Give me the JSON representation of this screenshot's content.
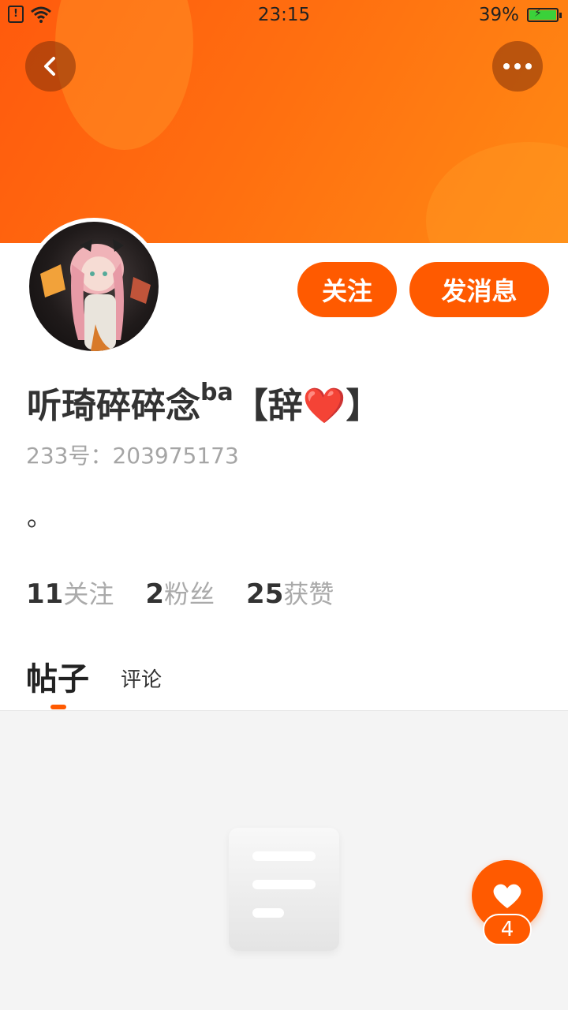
{
  "status_bar": {
    "time": "23:15",
    "battery_percent": "39%",
    "battery_level": 0.39
  },
  "header": {
    "back_icon": "chevron-left-icon",
    "more_icon": "more-dots-icon"
  },
  "profile": {
    "avatar": "anime-girl-avatar",
    "follow_label": "关注",
    "message_label": "发消息",
    "name_main": "听琦碎碎念",
    "name_sup": "ba",
    "name_bracket_open": "【辞",
    "name_heart": "❤️",
    "name_bracket_close": "】",
    "uid": "233号：203975173",
    "bio": "。"
  },
  "stats": {
    "following_count": "11",
    "following_label": "关注",
    "fans_count": "2",
    "fans_label": "粉丝",
    "likes_count": "25",
    "likes_label": "获赞"
  },
  "tabs": {
    "posts": "帖子",
    "comments": "评论"
  },
  "like_fab": {
    "count": "4"
  },
  "colors": {
    "accent": "#ff5a00",
    "banner_start": "#ff5a0d",
    "banner_end": "#ff8a14"
  }
}
